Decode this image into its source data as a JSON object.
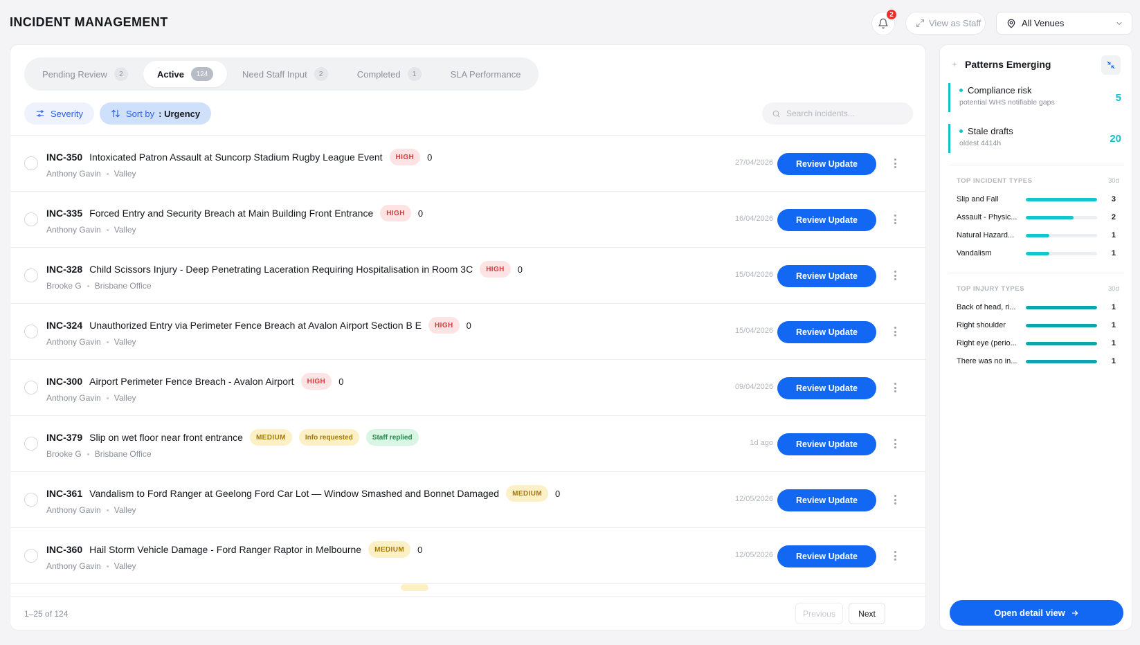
{
  "header": {
    "title": "INCIDENT MANAGEMENT",
    "notification_count": "2",
    "view_as_staff": "View as Staff",
    "venue": "All Venues"
  },
  "tabs": [
    {
      "label": "Pending Review",
      "count": "2"
    },
    {
      "label": "Active",
      "count": "124"
    },
    {
      "label": "Need Staff Input",
      "count": "2"
    },
    {
      "label": "Completed",
      "count": "1"
    },
    {
      "label": "SLA Performance",
      "count": ""
    }
  ],
  "filters": {
    "severity": "Severity",
    "sort_label": "Sort by",
    "sort_value": ": Urgency",
    "search_placeholder": "Search incidents..."
  },
  "review_label": "Review Update",
  "incidents": [
    {
      "id": "INC-350",
      "title": "Intoxicated Patron Assault at Suncorp Stadium Rugby League Event",
      "severity": "HIGH",
      "comments": "0",
      "reporter": "Anthony Gavin",
      "venue": "Valley",
      "date": "27/04/2026"
    },
    {
      "id": "INC-335",
      "title": "Forced Entry and Security Breach at Main Building Front Entrance",
      "severity": "HIGH",
      "comments": "0",
      "reporter": "Anthony Gavin",
      "venue": "Valley",
      "date": "16/04/2026"
    },
    {
      "id": "INC-328",
      "title": "Child Scissors Injury - Deep Penetrating Laceration Requiring Hospitalisation in Room 3C",
      "severity": "HIGH",
      "comments": "0",
      "reporter": "Brooke G",
      "venue": "Brisbane Office",
      "date": "15/04/2026"
    },
    {
      "id": "INC-324",
      "title": "Unauthorized Entry via Perimeter Fence Breach at Avalon Airport Section B E",
      "severity": "HIGH",
      "comments": "0",
      "reporter": "Anthony Gavin",
      "venue": "Valley",
      "date": "15/04/2026"
    },
    {
      "id": "INC-300",
      "title": "Airport Perimeter Fence Breach - Avalon Airport",
      "severity": "HIGH",
      "comments": "0",
      "reporter": "Anthony Gavin",
      "venue": "Valley",
      "date": "09/04/2026"
    },
    {
      "id": "INC-379",
      "title": "Slip on wet floor near front entrance",
      "severity": "MEDIUM",
      "comments": "",
      "tags": [
        "Info requested",
        "Staff replied"
      ],
      "reporter": "Brooke G",
      "venue": "Brisbane Office",
      "date": "1d ago"
    },
    {
      "id": "INC-361",
      "title": "Vandalism to Ford Ranger at Geelong Ford Car Lot — Window Smashed and Bonnet Damaged",
      "severity": "MEDIUM",
      "comments": "0",
      "reporter": "Anthony Gavin",
      "venue": "Valley",
      "date": "12/05/2026"
    },
    {
      "id": "INC-360",
      "title": "Hail Storm Vehicle Damage - Ford Ranger Raptor in Melbourne",
      "severity": "MEDIUM",
      "comments": "0",
      "reporter": "Anthony Gavin",
      "venue": "Valley",
      "date": "12/05/2026"
    }
  ],
  "pagination": {
    "range": "1–25 of 124",
    "previous": "Previous",
    "next": "Next"
  },
  "patterns": {
    "title": "Patterns Emerging",
    "alerts": [
      {
        "title": "Compliance risk",
        "subtitle": "potential WHS notifiable gaps",
        "value": "5"
      },
      {
        "title": "Stale drafts",
        "subtitle": "oldest 4414h",
        "value": "20"
      }
    ],
    "incident_types": {
      "label": "TOP INCIDENT TYPES",
      "period": "30d",
      "color": "#14c6cc",
      "items": [
        {
          "label": "Slip and Fall",
          "value": 3,
          "display": "3"
        },
        {
          "label": "Assault - Physic...",
          "value": 2,
          "display": "2"
        },
        {
          "label": "Natural Hazard...",
          "value": 1,
          "display": "1"
        },
        {
          "label": "Vandalism",
          "value": 1,
          "display": "1"
        }
      ],
      "max": 3
    },
    "injury_types": {
      "label": "TOP INJURY TYPES",
      "period": "30d",
      "color": "#0ea5aa",
      "items": [
        {
          "label": "Back of head, ri...",
          "value": 1,
          "display": "1"
        },
        {
          "label": "Right shoulder",
          "value": 1,
          "display": "1"
        },
        {
          "label": "Right eye (perio...",
          "value": 1,
          "display": "1"
        },
        {
          "label": "There was no in...",
          "value": 1,
          "display": "1"
        }
      ],
      "max": 1
    },
    "open_detail": "Open detail view"
  }
}
